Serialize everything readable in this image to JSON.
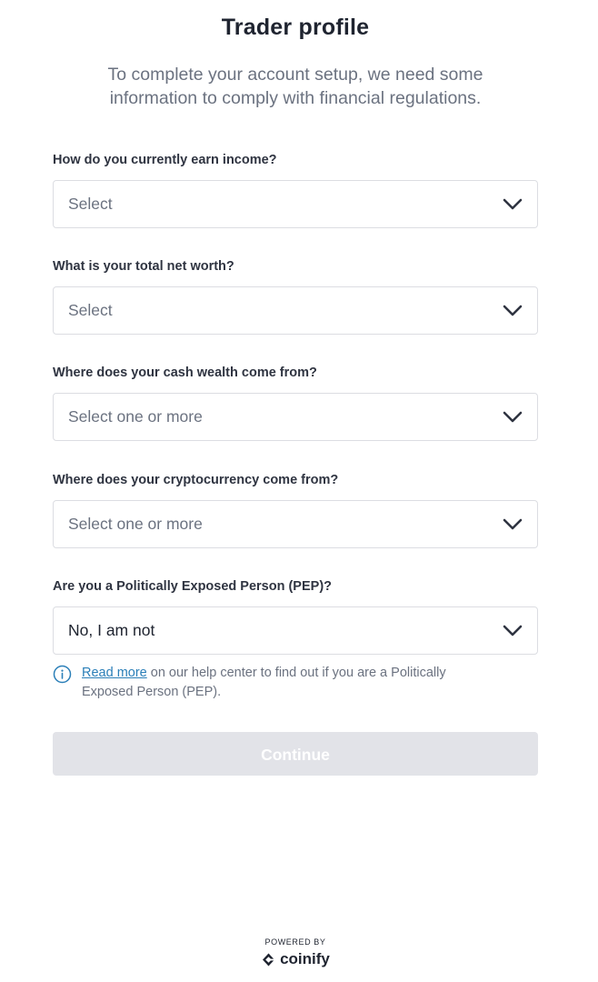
{
  "page": {
    "title": "Trader profile",
    "subtitle": "To complete your account setup, we need some information to comply with financial regulations."
  },
  "fields": [
    {
      "label": "How do you currently earn income?",
      "value": "Select",
      "filled": false
    },
    {
      "label": "What is your total net worth?",
      "value": "Select",
      "filled": false
    },
    {
      "label": "Where does your cash wealth come from?",
      "value": "Select one or more",
      "filled": false
    },
    {
      "label": "Where does your cryptocurrency come from?",
      "value": "Select one or more",
      "filled": false
    },
    {
      "label": "Are you a Politically Exposed Person (PEP)?",
      "value": "No, I am not",
      "filled": true
    }
  ],
  "info": {
    "icon": "info-icon",
    "link_text": "Read more",
    "text": " on our help center to find out if you are a Politically Exposed Person (PEP)."
  },
  "actions": {
    "continue_label": "Continue",
    "continue_enabled": false
  },
  "footer": {
    "powered_by": "POWERED BY",
    "brand": "coinify"
  },
  "colors": {
    "accent_link": "#2b7fb8",
    "disabled_button": "#e2e3e8",
    "border": "#dcdde2",
    "text_primary": "#1f2430",
    "text_muted": "#6b7280"
  }
}
